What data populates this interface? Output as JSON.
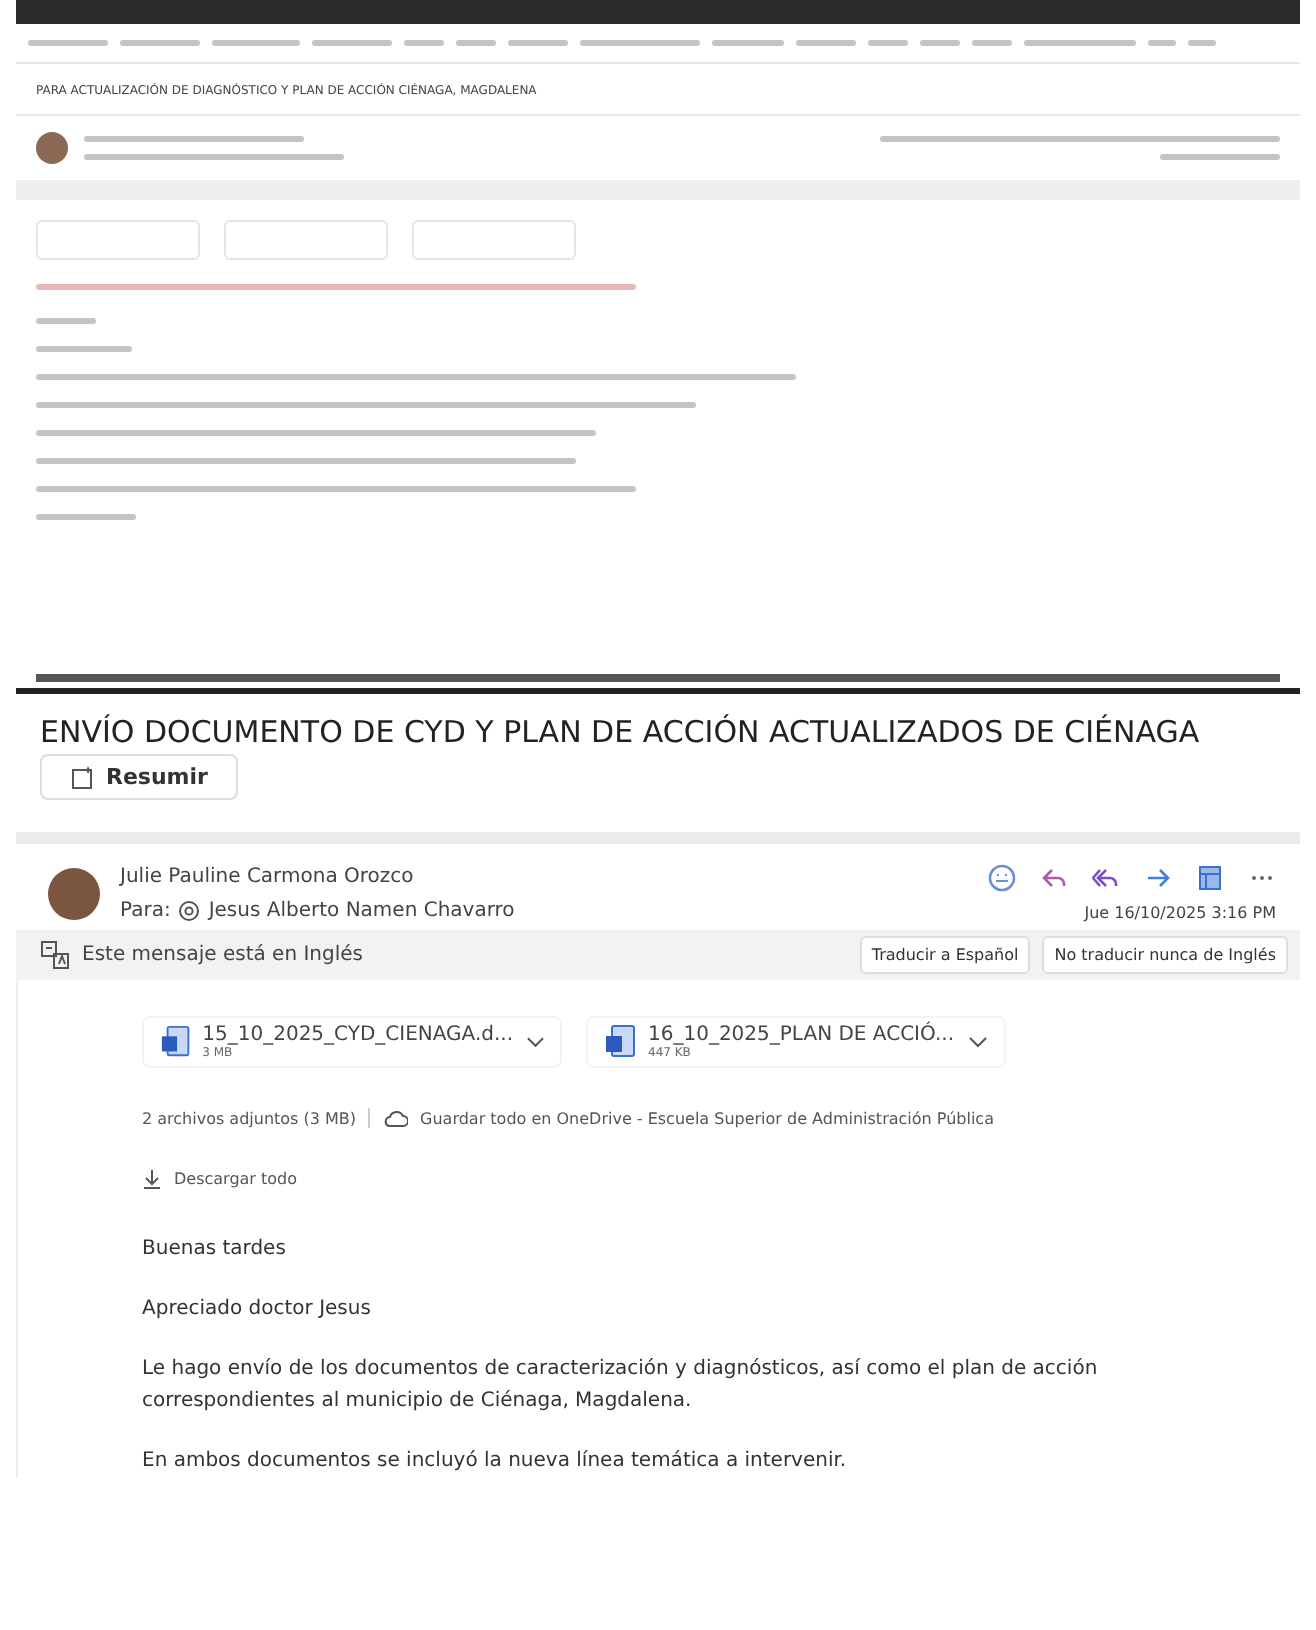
{
  "first_email": {
    "subject": "PARA ACTUALIZACIÓN DE DIAGNÓSTICO Y PLAN DE ACCIÓN CIÉNAGA, MAGDALENA"
  },
  "email": {
    "subject": "ENVÍO DOCUMENTO DE CYD Y PLAN DE ACCIÓN ACTUALIZADOS DE CIÉNAGA",
    "summarize_button": "Resumir",
    "sender": "Julie Pauline Carmona Orozco",
    "to_label": "Para:",
    "recipient": "Jesus Alberto Namen Chavarro",
    "date": "Jue 16/10/2025 3:16 PM",
    "translation": {
      "message": "Este mensaje está en Inglés",
      "translate_button": "Traducir a Español",
      "never_button": "No traducir nunca de Inglés"
    },
    "attachments": [
      {
        "name": "15_10_2025_CYD_CIENAGA.d...",
        "size": "3 MB"
      },
      {
        "name": "16_10_2025_PLAN DE ACCIÓ...",
        "size": "447 KB"
      }
    ],
    "attachments_summary": "2 archivos adjuntos (3 MB)",
    "save_onedrive": "Guardar todo en OneDrive - Escuela Superior de Administración Pública",
    "download_all": "Descargar todo",
    "body": [
      "Buenas tardes",
      "Apreciado doctor Jesus",
      "Le hago envío de los documentos de caracterización y diagnósticos, así como el plan de acción correspondientes al municipio de Ciénaga, Magdalena.",
      "En ambos documentos se incluyó la nueva línea temática a intervenir."
    ]
  }
}
